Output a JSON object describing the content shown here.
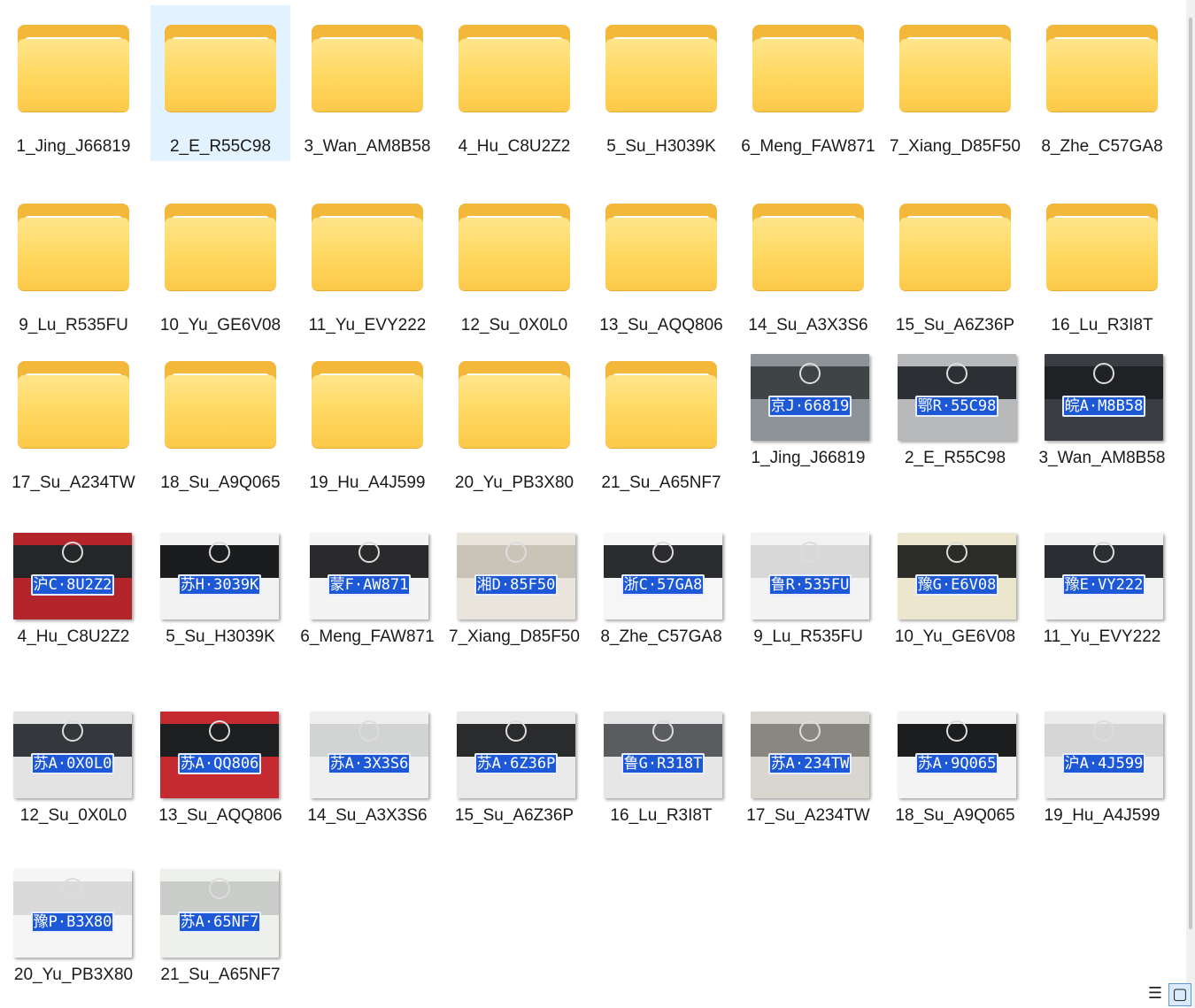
{
  "folders": [
    "1_Jing_J66819",
    "2_E_R55C98",
    "3_Wan_AM8B58",
    "4_Hu_C8U2Z2",
    "5_Su_H3039K",
    "6_Meng_FAW871",
    "7_Xiang_D85F50",
    "8_Zhe_C57GA8",
    "9_Lu_R535FU",
    "10_Yu_GE6V08",
    "11_Yu_EVY222",
    "12_Su_0X0L0",
    "13_Su_AQQ806",
    "14_Su_A3X3S6",
    "15_Su_A6Z36P",
    "16_Lu_R3I8T",
    "17_Su_A234TW",
    "18_Su_A9Q065",
    "19_Hu_A4J599",
    "20_Yu_PB3X80",
    "21_Su_A65NF7"
  ],
  "selected_folder": "2_E_R55C98",
  "images": [
    {
      "name": "1_Jing_J66819",
      "plate": "京J·66819",
      "car": "#3f4447",
      "body": "#8e9398"
    },
    {
      "name": "2_E_R55C98",
      "plate": "鄂R·55C98",
      "car": "#2c2f33",
      "body": "#b7b9bb"
    },
    {
      "name": "3_Wan_AM8B58",
      "plate": "皖A·M8B58",
      "car": "#1f2124",
      "body": "#3a3d41"
    },
    {
      "name": "4_Hu_C8U2Z2",
      "plate": "沪C·8U2Z2",
      "car": "#242628",
      "body": "#b3242b"
    },
    {
      "name": "5_Su_H3039K",
      "plate": "苏H·3039K",
      "car": "#1b1c1e",
      "body": "#f2f2f2"
    },
    {
      "name": "6_Meng_FAW871",
      "plate": "蒙F·AW871",
      "car": "#2a2a2c",
      "body": "#f4f4f4"
    },
    {
      "name": "7_Xiang_D85F50",
      "plate": "湘D·85F50",
      "car": "#c9c3b8",
      "body": "#e9e5dc"
    },
    {
      "name": "8_Zhe_C57GA8",
      "plate": "浙C·57GA8",
      "car": "#2b2c2f",
      "body": "#f6f6f6"
    },
    {
      "name": "9_Lu_R535FU",
      "plate": "鲁R·535FU",
      "car": "#d8d8d8",
      "body": "#f3f3f3"
    },
    {
      "name": "10_Yu_GE6V08",
      "plate": "豫G·E6V08",
      "car": "#2b2b28",
      "body": "#ece6cf"
    },
    {
      "name": "11_Yu_EVY222",
      "plate": "豫E·VY222",
      "car": "#2a2d32",
      "body": "#f2f2f2"
    },
    {
      "name": "12_Su_0X0L0",
      "plate": "苏A·0X0L0",
      "car": "#34383c",
      "body": "#e3e3e3"
    },
    {
      "name": "13_Su_AQQ806",
      "plate": "苏A·QQ806",
      "car": "#1d1e20",
      "body": "#c42a30"
    },
    {
      "name": "14_Su_A3X3S6",
      "plate": "苏A·3X3S6",
      "car": "#d2d3d3",
      "body": "#efefef"
    },
    {
      "name": "15_Su_A6Z36P",
      "plate": "苏A·6Z36P",
      "car": "#2a2b2c",
      "body": "#e9e9e9"
    },
    {
      "name": "16_Lu_R3I8T",
      "plate": "鲁G·R318T",
      "car": "#5a5c5f",
      "body": "#e6e6e6"
    },
    {
      "name": "17_Su_A234TW",
      "plate": "苏A·234TW",
      "car": "#8a8780",
      "body": "#d9d6cf"
    },
    {
      "name": "18_Su_A9Q065",
      "plate": "苏A·9Q065",
      "car": "#1c1d1f",
      "body": "#f3f3f3"
    },
    {
      "name": "19_Hu_A4J599",
      "plate": "沪A·4J599",
      "car": "#d6d6d6",
      "body": "#ededed"
    },
    {
      "name": "20_Yu_PB3X80",
      "plate": "豫P·B3X80",
      "car": "#dadada",
      "body": "#f5f5f5"
    },
    {
      "name": "21_Su_A65NF7",
      "plate": "苏A·65NF7",
      "car": "#c9ccc8",
      "body": "#eef0ec"
    }
  ],
  "icons": {
    "folder": "folder-icon",
    "details_view": "details-view-icon",
    "tiles_view": "large-icons-view-icon"
  },
  "glyphs": {
    "details_view": "☰",
    "tiles_view": "▢"
  },
  "colors": {
    "folder": "#ffd75e",
    "selection": "#cce8ff",
    "plate": "#1d58d6"
  }
}
